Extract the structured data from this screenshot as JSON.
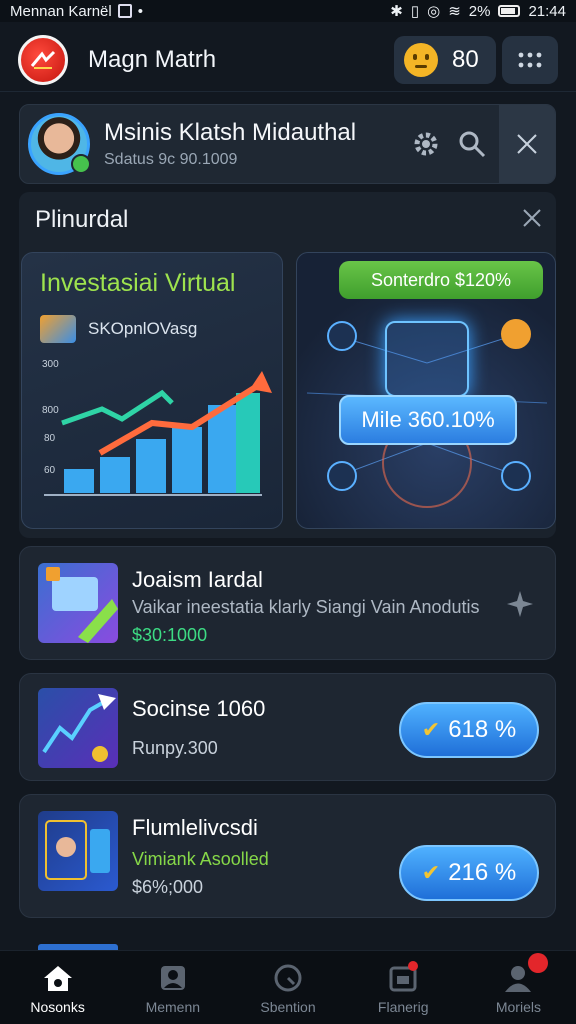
{
  "status_bar": {
    "carrier": "Mennan Karnël",
    "battery_text": "2%",
    "time": "21:44"
  },
  "header": {
    "title": "Magn Matrh",
    "score": "80",
    "icons": {
      "logo": "brand-logo-icon",
      "mood": "neutral-face-icon",
      "menu": "dots-grid-icon"
    }
  },
  "profile": {
    "name": "Msinis Klatsh Midauthal",
    "status": "Sdatus 9c 90.1009"
  },
  "section": {
    "title": "Plinurdal",
    "chart_tile": {
      "title": "Investasiai Virtual",
      "subtitle": "SKOpnlOVasg",
      "y_ticks": [
        "300",
        "800",
        "80",
        "60"
      ]
    },
    "network_tile": {
      "top_badge": "Sonterdro $120%",
      "value_badge": "Mile 360.10%"
    }
  },
  "cards": [
    {
      "title": "Joaism Iardal",
      "description": "Vaikar ineestatia klarly Siangi Vain Anodutis",
      "price": "$30:1000"
    },
    {
      "title": "Socinse 1060",
      "meta": "Runpy.300",
      "percent": "618 %"
    },
    {
      "title": "Flumlelivcsdi",
      "subtitle": "Vimiank Asoolled",
      "meta": "$6%;000",
      "percent": "216 %"
    }
  ],
  "bottom_nav": [
    {
      "label": "Nosonks",
      "icon": "home-icon"
    },
    {
      "label": "Memenn",
      "icon": "profile-icon"
    },
    {
      "label": "Sbention",
      "icon": "search-icon"
    },
    {
      "label": "Flanerig",
      "icon": "calendar-icon"
    },
    {
      "label": "Moriels",
      "icon": "user-icon"
    }
  ],
  "colors": {
    "accent_green": "#9ee34e",
    "accent_blue": "#3a8ee6",
    "price_green": "#3ddc84",
    "badge_red": "#e3262b"
  }
}
